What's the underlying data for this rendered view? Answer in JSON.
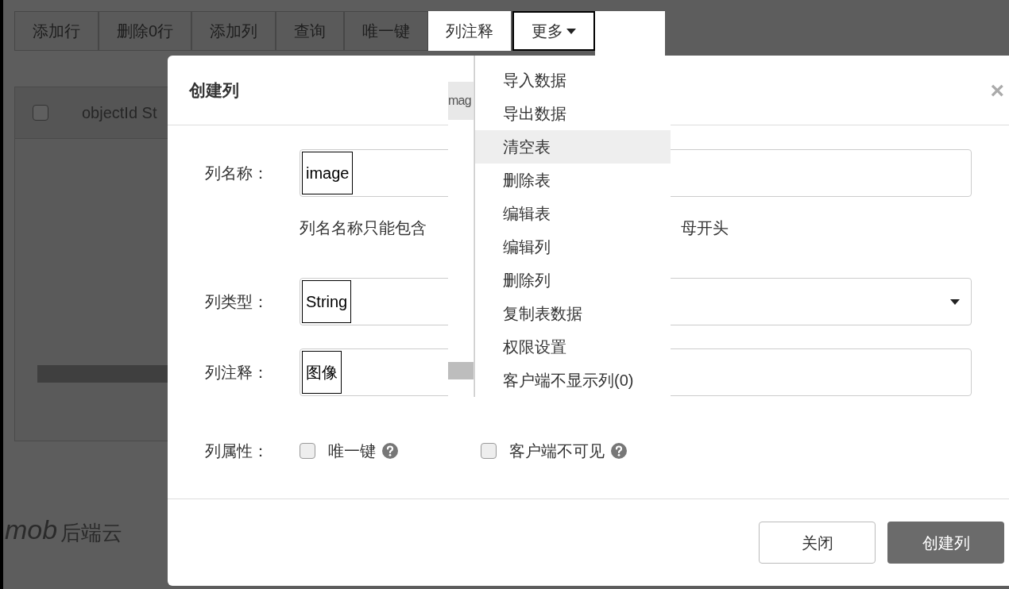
{
  "toolbar": {
    "buttons": [
      {
        "label": "添加行",
        "dimmed": true,
        "kind": "plain"
      },
      {
        "label": "删除0行",
        "dimmed": true,
        "kind": "plain"
      },
      {
        "label": "添加列",
        "dimmed": true,
        "kind": "plain"
      },
      {
        "label": "查询",
        "dimmed": true,
        "kind": "plain"
      },
      {
        "label": "唯一键",
        "dimmed": true,
        "kind": "plain"
      },
      {
        "label": "列注释",
        "dimmed": false,
        "kind": "plain"
      },
      {
        "label": "更多",
        "dimmed": false,
        "kind": "dropdown"
      }
    ]
  },
  "table": {
    "header": {
      "checked": false,
      "column_1": "objectId St",
      "column_2": "mag"
    }
  },
  "logo": {
    "name": "mob",
    "tagline": "后端云"
  },
  "dialog": {
    "title": "创建列",
    "close": "×",
    "fields": [
      {
        "kind": "text",
        "label": "列名称：",
        "value": "image",
        "hint_left": "列名名称只能包含",
        "hint_right": "母开头"
      },
      {
        "kind": "select",
        "label": "列类型：",
        "value": "String"
      },
      {
        "kind": "text",
        "label": "列注释：",
        "value": "图像"
      }
    ],
    "attributes": {
      "label": "列属性：",
      "options": [
        {
          "label": "唯一键",
          "checked": false
        },
        {
          "label": "客户端不可见",
          "checked": false
        }
      ]
    },
    "buttons": [
      {
        "label": "关闭",
        "kind": "default"
      },
      {
        "label": "创建列",
        "kind": "primary"
      }
    ]
  },
  "menu": {
    "items": [
      {
        "label": "导入数据",
        "selected": false
      },
      {
        "label": "导出数据",
        "selected": false
      },
      {
        "label": "清空表",
        "selected": true
      },
      {
        "label": "删除表",
        "selected": false
      },
      {
        "label": "编辑表",
        "selected": false
      },
      {
        "label": "编辑列",
        "selected": false
      },
      {
        "label": "删除列",
        "selected": false
      },
      {
        "label": "复制表数据",
        "selected": false
      },
      {
        "label": "权限设置",
        "selected": false
      },
      {
        "label": "客户端不显示列(0)",
        "selected": false
      }
    ]
  }
}
